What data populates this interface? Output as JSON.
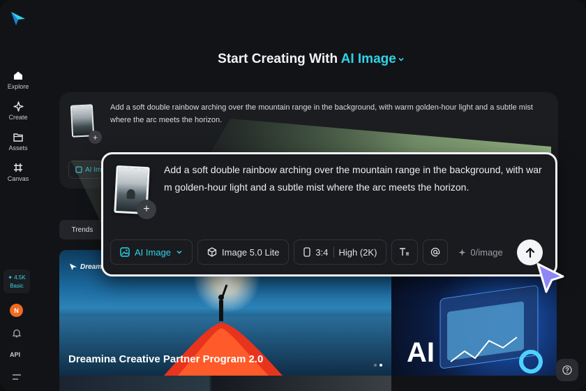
{
  "sidebar": {
    "items": [
      {
        "label": "Explore",
        "icon": "home-icon"
      },
      {
        "label": "Create",
        "icon": "sparkle-icon"
      },
      {
        "label": "Assets",
        "icon": "folder-icon"
      },
      {
        "label": "Canvas",
        "icon": "canvas-icon"
      }
    ],
    "credits": {
      "amount": "✦ 4.5K",
      "plan": "Basic"
    },
    "avatar_initial": "N",
    "api_label": "API"
  },
  "header": {
    "title_prefix": "Start Creating With",
    "title_accent": "AI Image"
  },
  "background_card": {
    "prompt": "Add a soft double rainbow arching over the mountain range in the background, with warm golden-hour light and a subtle mist where the arc meets the horizon.",
    "chip_label": "AI Im"
  },
  "trends_tab": "Trends",
  "banner": {
    "brand": "Dreamina",
    "title": "Dreamina Creative Partner Program 2.0",
    "side_text": "AI"
  },
  "prompt_card": {
    "prompt": "Add a soft double rainbow arching over the mountain range in the background, with warm golden-hour light and a subtle mist where the arc meets the horizon.",
    "toolbar": {
      "mode": "AI Image",
      "model": "Image 5.0 Lite",
      "ratio": "3:4",
      "quality": "High (2K)",
      "cost": "0/image"
    }
  },
  "colors": {
    "accent": "#2fd3e8",
    "background": "#121316",
    "card": "#1a1b1f"
  }
}
